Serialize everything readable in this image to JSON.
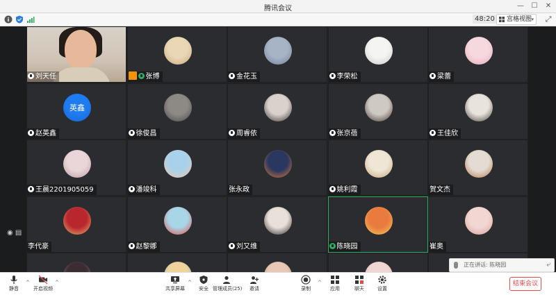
{
  "window": {
    "title": "腾讯会议"
  },
  "status": {
    "timer": "48:20",
    "view_mode": "宫格视图"
  },
  "participants": [
    {
      "name": "刘天任",
      "kind": "video",
      "mic": "white"
    },
    {
      "name": "张博",
      "kind": "avatar",
      "mic": "green",
      "host_badge": true,
      "colors": [
        "#e9d7b5",
        "#caa77a"
      ]
    },
    {
      "name": "金花玉",
      "kind": "avatar",
      "mic": "white",
      "colors": [
        "#a7b4c6",
        "#6f7f96"
      ]
    },
    {
      "name": "李荣松",
      "kind": "avatar",
      "mic": "white",
      "colors": [
        "#f4f4f2",
        "#c9c9c7"
      ]
    },
    {
      "name": "梁蕾",
      "kind": "avatar",
      "mic": "white",
      "colors": [
        "#f6d8df",
        "#e7a9b8"
      ]
    },
    {
      "name": "赵英鑫",
      "kind": "avatar",
      "mic": "white",
      "avatar_text": "英鑫",
      "colors": [
        "#1f7cf0",
        "#1668d6"
      ]
    },
    {
      "name": "徐俊昌",
      "kind": "avatar",
      "mic": "white",
      "colors": [
        "#8d8a86",
        "#4a4745"
      ]
    },
    {
      "name": "周睿依",
      "kind": "avatar",
      "mic": "white",
      "colors": [
        "#d9d2cc",
        "#3a302b"
      ]
    },
    {
      "name": "张京蓓",
      "kind": "avatar",
      "mic": "white",
      "colors": [
        "#cfc9c3",
        "#403630"
      ]
    },
    {
      "name": "王佳欣",
      "kind": "avatar",
      "mic": "white",
      "colors": [
        "#e9e3de",
        "#48423d"
      ]
    },
    {
      "name": "王晨2201905059",
      "kind": "avatar",
      "mic": "white",
      "colors": [
        "#ead6d8",
        "#b99aa0"
      ]
    },
    {
      "name": "潘竣科",
      "kind": "avatar",
      "mic": "white",
      "colors": [
        "#a9d2ea",
        "#eec8a8"
      ]
    },
    {
      "name": "张永政",
      "kind": "avatar",
      "mic": "none",
      "colors": [
        "#2a3760",
        "#e07a3a"
      ]
    },
    {
      "name": "姚利霞",
      "kind": "avatar",
      "mic": "white",
      "colors": [
        "#efe6d5",
        "#c3a779"
      ]
    },
    {
      "name": "贺文杰",
      "kind": "avatar",
      "mic": "none",
      "colors": [
        "#e4dcd4",
        "#b47b4c"
      ]
    },
    {
      "name": "李代豪",
      "kind": "avatar",
      "mic": "none",
      "colors": [
        "#b8272e",
        "#e7b26a"
      ]
    },
    {
      "name": "赵黎娜",
      "kind": "avatar",
      "mic": "white",
      "colors": [
        "#a9d5e9",
        "#e24b3e"
      ]
    },
    {
      "name": "刘又维",
      "kind": "avatar",
      "mic": "white",
      "colors": [
        "#e9e0d9",
        "#2a2421"
      ]
    },
    {
      "name": "陈晓园",
      "kind": "avatar",
      "mic": "green",
      "active": true,
      "colors": [
        "#e97b3f",
        "#f3c95a"
      ]
    },
    {
      "name": "崔奥",
      "kind": "avatar",
      "mic": "none",
      "colors": [
        "#f2d6d2",
        "#d9a09a"
      ]
    },
    {
      "name": "",
      "kind": "avatar",
      "mic": "none",
      "colors": [
        "#3b2c33",
        "#c07b8a"
      ]
    },
    {
      "name": "",
      "kind": "avatar",
      "mic": "none",
      "colors": [
        "#f0d29a",
        "#6ab0d8"
      ]
    },
    {
      "name": "",
      "kind": "avatar",
      "mic": "none",
      "colors": [
        "#e8c9b7",
        "#b27b64"
      ]
    },
    {
      "name": "",
      "kind": "avatar",
      "mic": "none",
      "colors": [
        "#f1d7d3",
        "#d99c95"
      ]
    },
    {
      "name": "",
      "kind": "avatar",
      "mic": "none",
      "colors": [
        "#1f7cf0",
        "#1668d6"
      ]
    }
  ],
  "chat": {
    "text": "正在讲话: 陈晓园"
  },
  "toolbar": {
    "items": [
      {
        "key": "mic",
        "label": "静音"
      },
      {
        "key": "video",
        "label": "开启视频"
      },
      {
        "key": "share",
        "label": "共享屏幕"
      },
      {
        "key": "security",
        "label": "安全"
      },
      {
        "key": "members",
        "label": "管理成员(25)"
      },
      {
        "key": "invite",
        "label": "邀请"
      },
      {
        "key": "record",
        "label": "录制"
      },
      {
        "key": "apps",
        "label": "应用"
      },
      {
        "key": "chat",
        "label": "聊天"
      },
      {
        "key": "settings",
        "label": "设置"
      }
    ],
    "end_label": "结束会议"
  },
  "colors": {
    "accent_green": "#2fae63",
    "end_red": "#e24b4b",
    "host_orange": "#f39300"
  }
}
